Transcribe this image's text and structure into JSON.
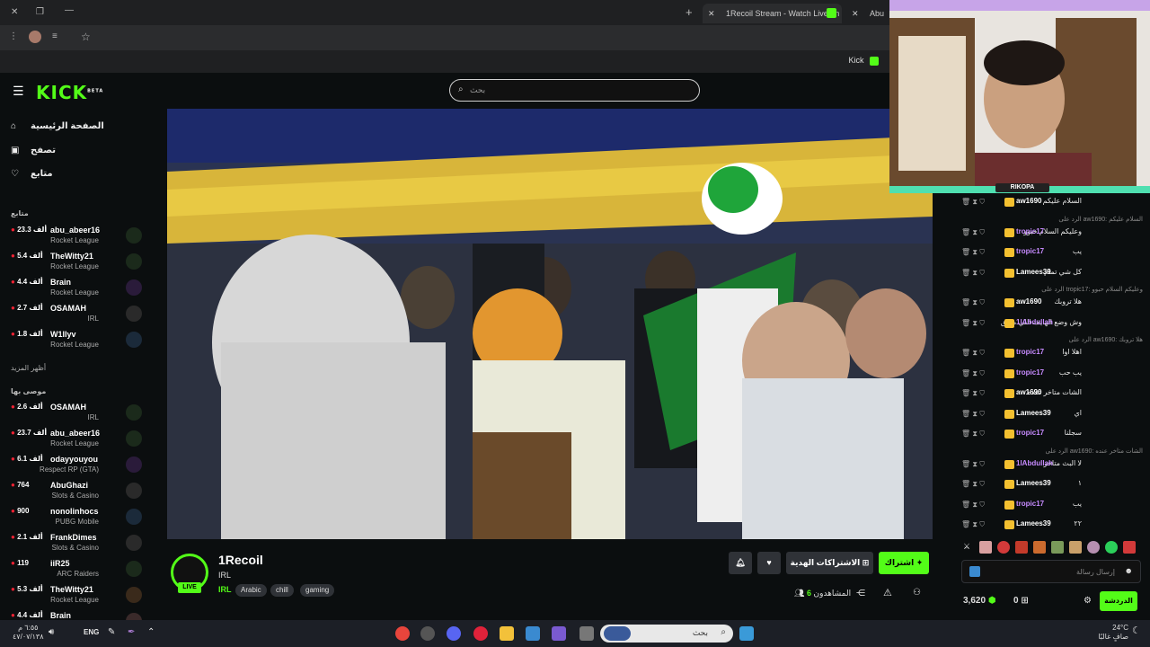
{
  "browser": {
    "tabs": [
      {
        "title": "1Recoil Stream - Watch Live on",
        "active": true
      },
      {
        "title": "Abu"
      }
    ],
    "bookmark_label": "Kick"
  },
  "header": {
    "logo": "KICK",
    "beta": "BETA",
    "search_placeholder": "بحث"
  },
  "sidebar": {
    "nav": [
      {
        "label": "الصفحة الرئيسية",
        "icon": "home-icon"
      },
      {
        "label": "تصفح",
        "icon": "browse-icon"
      },
      {
        "label": "متابع",
        "icon": "heart-icon"
      }
    ],
    "following_title": "متابع",
    "following": [
      {
        "name": "abu_abeer16",
        "viewers": "23.3 ألف",
        "category": "Rocket League"
      },
      {
        "name": "TheWitty21",
        "viewers": "5.4 ألف",
        "category": "Rocket League"
      },
      {
        "name": "Brain",
        "viewers": "4.4 ألف",
        "category": "Rocket League"
      },
      {
        "name": "OSAMAH",
        "viewers": "2.7 ألف",
        "category": "IRL"
      },
      {
        "name": "W1llyv",
        "viewers": "1.8 ألف",
        "category": "Rocket League"
      }
    ],
    "show_more": "أظهر المزيد",
    "recommended_title": "موصى بها",
    "recommended": [
      {
        "name": "OSAMAH",
        "viewers": "2.6 ألف",
        "category": "IRL"
      },
      {
        "name": "abu_abeer16",
        "viewers": "23.7 ألف",
        "category": "Rocket League"
      },
      {
        "name": "odayyouyou",
        "viewers": "6.1 ألف",
        "category": "Respect RP (GTA)"
      },
      {
        "name": "AbuGhazi",
        "viewers": "764",
        "category": "Slots & Casino"
      },
      {
        "name": "nonolinhocs",
        "viewers": "900",
        "category": "PUBG Mobile"
      },
      {
        "name": "FrankDimes",
        "viewers": "2.1 ألف",
        "category": "Slots & Casino"
      },
      {
        "name": "iiR25",
        "viewers": "119",
        "category": "ARC Raiders"
      },
      {
        "name": "TheWitty21",
        "viewers": "5.3 ألف",
        "category": "Rocket League"
      },
      {
        "name": "Brain",
        "viewers": "4.4 ألف",
        "category": ""
      }
    ]
  },
  "stream": {
    "streamer": "1Recoil",
    "category": "IRL",
    "live": "LIVE",
    "language": "IRL",
    "tags": [
      "Arabic",
      "chill",
      "gaming"
    ],
    "viewers_label": "المشاهدون",
    "viewers": "6",
    "subscribe": "اشتراك",
    "gift_subs": "الاشتراكات الهدية"
  },
  "webcam": {
    "nameplate": "RIKOPA"
  },
  "chat": {
    "messages": [
      {
        "type": "msg",
        "user": "aw1690",
        "text": "السلام عليكم",
        "color": "#ffffff"
      },
      {
        "type": "reply",
        "text": "الرد على aw1690: السلام عليكم"
      },
      {
        "type": "msg",
        "user": "tropic17",
        "text": "وعليكم السلام حبوو",
        "color": "#c78bff"
      },
      {
        "type": "msg",
        "user": "tropic17",
        "text": "يب",
        "color": "#c78bff"
      },
      {
        "type": "msg",
        "user": "Lamees39",
        "text": "كل شي تمام",
        "color": "#ffffff"
      },
      {
        "type": "reply",
        "text": "الرد على tropic17: وعليكم السلام حبوو"
      },
      {
        "type": "msg",
        "user": "aw1690",
        "text": "هلا تروبك",
        "color": "#ffffff"
      },
      {
        "type": "msg",
        "user": "1lAbdullah",
        "text": "وش وضع الهايف اللي معلق",
        "color": "#c78bff"
      },
      {
        "type": "reply",
        "text": "الرد على aw1690: هلا تروبك"
      },
      {
        "type": "msg",
        "user": "tropic17",
        "text": "اهلا اوا",
        "color": "#c78bff"
      },
      {
        "type": "msg",
        "user": "tropic17",
        "text": "يب حب",
        "color": "#c78bff"
      },
      {
        "type": "msg",
        "user": "aw1690",
        "text": "الشات متاخر عنده",
        "color": "#ffffff"
      },
      {
        "type": "msg",
        "user": "Lamees39",
        "text": "اي",
        "color": "#ffffff"
      },
      {
        "type": "msg",
        "user": "tropic17",
        "text": "سجلنا",
        "color": "#c78bff"
      },
      {
        "type": "reply",
        "text": "الرد على aw1690: الشات متاخر عنده"
      },
      {
        "type": "msg",
        "user": "1lAbdullah",
        "text": "لا البث متاخر",
        "color": "#c78bff"
      },
      {
        "type": "msg",
        "user": "Lamees39",
        "text": "١",
        "color": "#ffffff"
      },
      {
        "type": "msg",
        "user": "tropic17",
        "text": "يب",
        "color": "#c78bff"
      },
      {
        "type": "msg",
        "user": "Lamees39",
        "text": "٢٢",
        "color": "#ffffff"
      }
    ],
    "input_placeholder": "إرسال رسالة",
    "points": "3,620",
    "count": "0",
    "send_label": "الدردشة"
  },
  "taskbar": {
    "lang": "ENG",
    "time": "٦:٥٥ م",
    "date": "٤٧/٠٧/١٣٨",
    "search_placeholder": "بحث",
    "weather_temp": "24°C",
    "weather_desc": "صافٍ غالبًا"
  },
  "colors": {
    "accent": "#53fc18",
    "bg": "#0b0e0f"
  }
}
